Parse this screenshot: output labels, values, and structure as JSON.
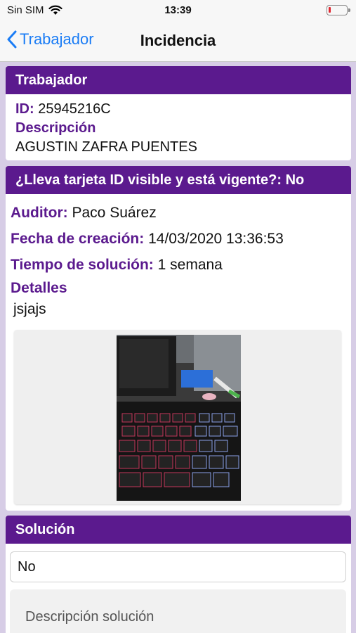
{
  "status_bar": {
    "carrier": "Sin SIM",
    "time": "13:39"
  },
  "nav": {
    "back_label": "Trabajador",
    "title": "Incidencia"
  },
  "worker_card": {
    "header": "Trabajador",
    "id_label": "ID:",
    "id_value": "25945216C",
    "description_label": "Descripción",
    "description_value": "AGUSTIN ZAFRA PUENTES"
  },
  "incident_card": {
    "header": "¿Lleva tarjeta ID visible y está vigente?: No",
    "auditor_label": "Auditor:",
    "auditor_value": "Paco Suárez",
    "created_label": "Fecha de creación:",
    "created_value": "14/03/2020 13:36:53",
    "solution_time_label": "Tiempo de solución:",
    "solution_time_value": "1 semana",
    "details_label": "Detalles",
    "details_value": "jsjajs"
  },
  "solution_card": {
    "header": "Solución",
    "input_value": "No",
    "textarea_placeholder": "Descripción solución"
  },
  "colors": {
    "accent_purple": "#5b1a8e",
    "ios_blue": "#1a7cf5",
    "background": "#d7cde6"
  }
}
